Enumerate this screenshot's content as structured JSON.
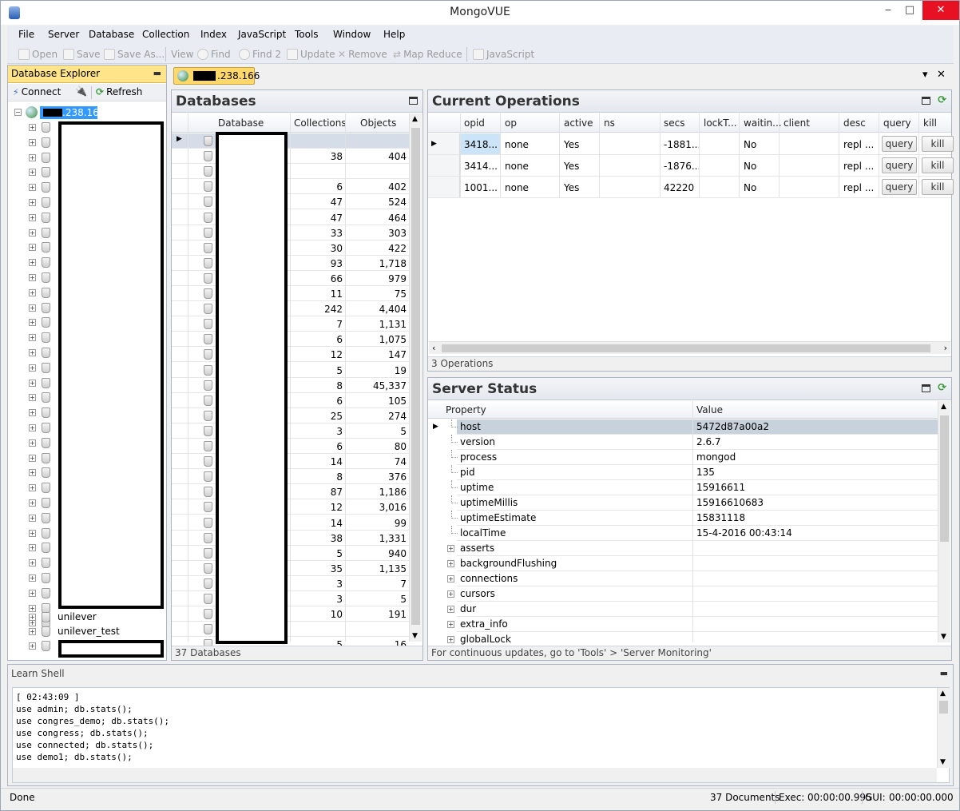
{
  "window": {
    "title": "MongoVUE",
    "minimize": "‒",
    "maximize": "□",
    "close": "✕"
  },
  "menu": [
    "File",
    "Server",
    "Database",
    "Collection",
    "Index",
    "JavaScript",
    "Tools",
    "Window",
    "Help"
  ],
  "toolbar": {
    "open": "Open",
    "save": "Save",
    "save_as": "Save As...",
    "view": "View",
    "find": "Find",
    "find2": "Find 2",
    "update": "Update",
    "remove": "Remove",
    "map_reduce": "Map Reduce",
    "javascript": "JavaScript"
  },
  "explorer": {
    "title": "Database Explorer",
    "pin": "📌",
    "connect": "Connect",
    "refresh": "Refresh",
    "server_label": ".238.166",
    "visible_dbs": [
      "unilever",
      "unilever_test"
    ]
  },
  "tabs": {
    "connection_label": ".238.166",
    "menu_icon": "▾",
    "close_icon": "✕"
  },
  "databases": {
    "title": "Databases",
    "columns": [
      "Database",
      "Collections",
      "Objects"
    ],
    "rows": [
      [
        "",
        ""
      ],
      [
        "38",
        "404"
      ],
      [
        "",
        ""
      ],
      [
        "6",
        "402"
      ],
      [
        "47",
        "524"
      ],
      [
        "47",
        "464"
      ],
      [
        "33",
        "303"
      ],
      [
        "30",
        "422"
      ],
      [
        "93",
        "1,718"
      ],
      [
        "66",
        "979"
      ],
      [
        "11",
        "75"
      ],
      [
        "242",
        "4,404"
      ],
      [
        "7",
        "1,131"
      ],
      [
        "6",
        "1,075"
      ],
      [
        "12",
        "147"
      ],
      [
        "5",
        "19"
      ],
      [
        "8",
        "45,337"
      ],
      [
        "6",
        "105"
      ],
      [
        "25",
        "274"
      ],
      [
        "3",
        "5"
      ],
      [
        "6",
        "80"
      ],
      [
        "14",
        "74"
      ],
      [
        "8",
        "376"
      ],
      [
        "87",
        "1,186"
      ],
      [
        "12",
        "3,016"
      ],
      [
        "14",
        "99"
      ],
      [
        "38",
        "1,331"
      ],
      [
        "5",
        "940"
      ],
      [
        "35",
        "1,135"
      ],
      [
        "3",
        "7"
      ],
      [
        "3",
        "5"
      ],
      [
        "10",
        "191"
      ],
      [
        "",
        ""
      ],
      [
        "5",
        "16"
      ]
    ],
    "footer": "37 Databases"
  },
  "current_ops": {
    "title": "Current Operations",
    "columns": [
      "opid",
      "op",
      "active",
      "ns",
      "secs",
      "lockT...",
      "waitin...",
      "client",
      "desc",
      "query",
      "kill"
    ],
    "rows": [
      {
        "opid": "3418...",
        "op": "none",
        "active": "Yes",
        "ns": "",
        "secs": "-1881...",
        "lock": "",
        "waiting": "No",
        "client": "",
        "desc": "repl ...",
        "query": "query",
        "kill": "kill"
      },
      {
        "opid": "3414...",
        "op": "none",
        "active": "Yes",
        "ns": "",
        "secs": "-1876...",
        "lock": "",
        "waiting": "No",
        "client": "",
        "desc": "repl ...",
        "query": "query",
        "kill": "kill"
      },
      {
        "opid": "1001...",
        "op": "none",
        "active": "Yes",
        "ns": "",
        "secs": "42220",
        "lock": "",
        "waiting": "No",
        "client": "",
        "desc": "repl ...",
        "query": "query",
        "kill": "kill"
      }
    ],
    "footer": "3 Operations"
  },
  "server_status": {
    "title": "Server Status",
    "columns": [
      "Property",
      "Value"
    ],
    "rows": [
      {
        "property": "host",
        "value": "5472d87a00a2",
        "expandable": false
      },
      {
        "property": "version",
        "value": "2.6.7",
        "expandable": false
      },
      {
        "property": "process",
        "value": "mongod",
        "expandable": false
      },
      {
        "property": "pid",
        "value": "135",
        "expandable": false
      },
      {
        "property": "uptime",
        "value": "15916611",
        "expandable": false
      },
      {
        "property": "uptimeMillis",
        "value": "15916610683",
        "expandable": false
      },
      {
        "property": "uptimeEstimate",
        "value": "15831118",
        "expandable": false
      },
      {
        "property": "localTime",
        "value": "15-4-2016 00:43:14",
        "expandable": false
      },
      {
        "property": "asserts",
        "value": "",
        "expandable": true
      },
      {
        "property": "backgroundFlushing",
        "value": "",
        "expandable": true
      },
      {
        "property": "connections",
        "value": "",
        "expandable": true
      },
      {
        "property": "cursors",
        "value": "",
        "expandable": true
      },
      {
        "property": "dur",
        "value": "",
        "expandable": true
      },
      {
        "property": "extra_info",
        "value": "",
        "expandable": true
      },
      {
        "property": "globalLock",
        "value": "",
        "expandable": true
      }
    ],
    "footer": "For continuous updates, go to 'Tools' > 'Server Monitoring'"
  },
  "shell": {
    "title": "Learn Shell",
    "lines": [
      "[ 02:43:09 ]",
      "use admin; db.stats();",
      "use congres_demo; db.stats();",
      "use congress; db.stats();",
      "use connected; db.stats();",
      "use demo1; db.stats();"
    ]
  },
  "status": {
    "left": "Done",
    "documents": "37 Documents",
    "exec_label": "Exec:",
    "exec_time": "00:00:00.995",
    "gui_label": "GUI:",
    "gui_time": "00:00:00.000"
  }
}
